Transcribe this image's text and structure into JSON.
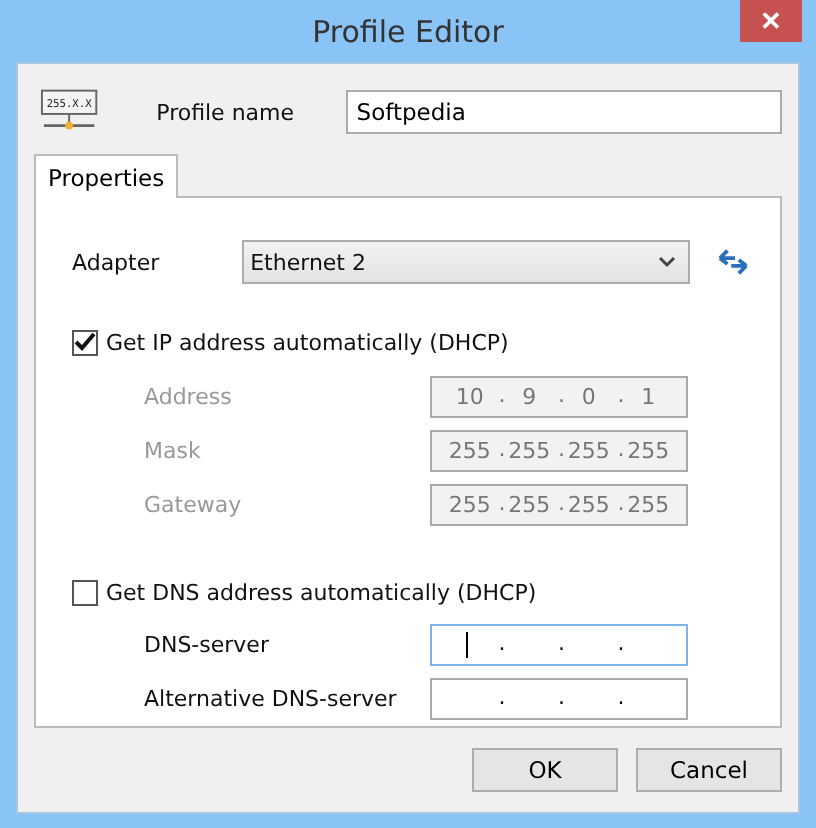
{
  "window": {
    "title": "Profile Editor",
    "close": "✕"
  },
  "profile": {
    "icon_text": "255.X.X",
    "label": "Profile name",
    "value": "Softpedia"
  },
  "tabs": [
    {
      "label": "Properties",
      "selected": true
    }
  ],
  "adapter": {
    "label": "Adapter",
    "value": "Ethernet 2"
  },
  "separator": ".",
  "sections": [
    {
      "label": "Get IP address automatically (DHCP)",
      "checked": true,
      "fields": [
        {
          "label": "Address",
          "disabled": true,
          "focused": false,
          "octets": [
            "10",
            "9",
            "0",
            "1"
          ]
        },
        {
          "label": "Mask",
          "disabled": true,
          "focused": false,
          "octets": [
            "255",
            "255",
            "255",
            "255"
          ]
        },
        {
          "label": "Gateway",
          "disabled": true,
          "focused": false,
          "octets": [
            "255",
            "255",
            "255",
            "255"
          ]
        }
      ]
    },
    {
      "label": "Get DNS address automatically (DHCP)",
      "checked": false,
      "fields": [
        {
          "label": "DNS-server",
          "disabled": false,
          "focused": true
        },
        {
          "label": "Alternative DNS-server",
          "disabled": false,
          "focused": false
        }
      ]
    }
  ],
  "buttons": [
    "OK",
    "Cancel"
  ]
}
